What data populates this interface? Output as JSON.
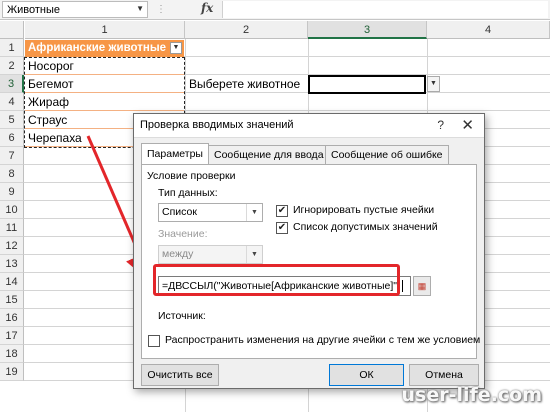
{
  "formula_bar": {
    "name_box": "Животные",
    "fx_label": "fx",
    "formula": ""
  },
  "columns": [
    "1",
    "2",
    "3",
    "4"
  ],
  "rows": [
    "1",
    "2",
    "3",
    "4",
    "5",
    "6",
    "7",
    "8",
    "9",
    "10",
    "11",
    "12",
    "13",
    "14",
    "15",
    "16",
    "17",
    "18",
    "19"
  ],
  "table": {
    "header": "Африканские животные",
    "items": [
      "Носорог",
      "Бегемот",
      "Жираф",
      "Страус",
      "Черепаха"
    ]
  },
  "prompt_label": "Выберете животное",
  "dialog": {
    "title": "Проверка вводимых значений",
    "help": "?",
    "close": "✕",
    "tabs": [
      "Параметры",
      "Сообщение для ввода",
      "Сообщение об ошибке"
    ],
    "section_title": "Условие проверки",
    "data_type_label": "Тип данных:",
    "data_type_value": "Список",
    "value_label": "Значение:",
    "value_value": "между",
    "ignore_blank_label": "Игнорировать пустые ячейки",
    "dropdown_list_label": "Список допустимых значений",
    "source_label": "Источник:",
    "source_value": "=ДВССЫЛ(\"Животные[Африканские животные]\")",
    "apply_all_label": "Распространить изменения на другие ячейки с тем же условием",
    "clear_all": "Очистить все",
    "ok": "ОК",
    "cancel": "Отмена"
  },
  "watermark": "user-life.com",
  "colors": {
    "table_header": "#f79646",
    "highlight": "#e3262a",
    "arrow": "#e3262a"
  }
}
